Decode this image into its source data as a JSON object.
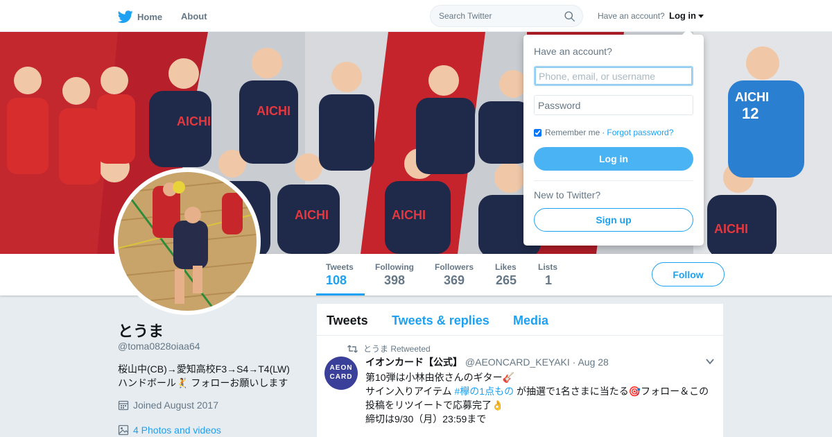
{
  "topbar": {
    "home_label": "Home",
    "about_label": "About",
    "search_placeholder": "Search Twitter",
    "have_account": "Have an account?",
    "login_label": "Log in"
  },
  "profile": {
    "name": "とうま",
    "handle": "@toma0828oiaa64",
    "bio_line1": "桜山中(CB)→愛知高校F3→S4→T4(LW)",
    "bio_line2": "ハンドボール🤾 フォローお願いします",
    "joined": "Joined August 2017",
    "photos": "4 Photos and videos"
  },
  "stats": [
    {
      "label": "Tweets",
      "value": "108"
    },
    {
      "label": "Following",
      "value": "398"
    },
    {
      "label": "Followers",
      "value": "369"
    },
    {
      "label": "Likes",
      "value": "265"
    },
    {
      "label": "Lists",
      "value": "1"
    }
  ],
  "follow_label": "Follow",
  "tabs": [
    "Tweets",
    "Tweets & replies",
    "Media"
  ],
  "tweet": {
    "context": "とうま Retweeted",
    "avatar_text_1": "AEON",
    "avatar_text_2": "CARD",
    "fullname": "イオンカード【公式】",
    "screen_name": "@AEONCARD_KEYAKI",
    "time": "· Aug 28",
    "line1": "第10弾は小林由依さんのギター🎸",
    "line2_pre": "サイン入りアイテム ",
    "line2_hashtag": "#欅の1点もの",
    "line2_post": " が抽選で1名さまに当たる🎯フォロー＆この",
    "line3": "投稿をリツイートで応募完了👌",
    "line4": "締切は9/30（月）23:59まで"
  },
  "login_dropdown": {
    "title": "Have an account?",
    "username_placeholder": "Phone, email, or username",
    "password_placeholder": "Password",
    "remember_me": "Remember me",
    "separator": "·",
    "forgot_password": "Forgot password?",
    "login_button": "Log in",
    "new_to_twitter": "New to Twitter?",
    "signup_button": "Sign up"
  },
  "colors": {
    "accent": "#1da1f2",
    "login_button": "#4ab3f4",
    "background": "#e6ecf0",
    "muted_text": "#657786"
  }
}
